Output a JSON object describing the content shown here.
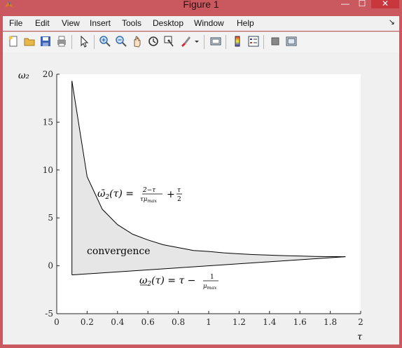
{
  "window": {
    "title": "Figure 1",
    "controls": {
      "minimize": "—",
      "maximize": "☐",
      "close": "✕"
    }
  },
  "menubar": {
    "items": [
      "File",
      "Edit",
      "View",
      "Insert",
      "Tools",
      "Desktop",
      "Window",
      "Help"
    ]
  },
  "toolbar": {
    "icons": [
      "new-figure-icon",
      "open-file-icon",
      "save-icon",
      "print-icon",
      "pointer-arrow-icon",
      "zoom-in-icon",
      "zoom-out-icon",
      "pan-hand-icon",
      "rotate-3d-icon",
      "data-cursor-icon",
      "brush-icon",
      "brush-dropdown-icon",
      "link-plot-icon",
      "colorbar-icon",
      "legend-icon",
      "hide-plot-tools-icon",
      "show-plot-tools-icon"
    ]
  },
  "chart_data": {
    "type": "area",
    "ylabel": "ω₂",
    "xlabel": "τ",
    "xlim": [
      0,
      2
    ],
    "ylim": [
      -5,
      20
    ],
    "xticks": [
      "0",
      "0.2",
      "0.4",
      "0.6",
      "0.8",
      "1",
      "1.2",
      "1.4",
      "1.6",
      "1.8",
      "2"
    ],
    "yticks": [
      "-5",
      "0",
      "5",
      "10",
      "15",
      "20"
    ],
    "grid": false,
    "fill_color": "#e6e6e6",
    "series": [
      {
        "x": [
          0.1,
          0.2,
          0.3,
          0.4,
          0.5,
          0.6,
          0.7,
          0.8,
          0.9,
          1.0,
          1.1,
          1.2,
          1.3,
          1.4,
          1.5,
          1.6,
          1.7,
          1.8,
          1.9
        ],
        "y": [
          19.3,
          9.3,
          5.9,
          4.3,
          3.3,
          2.7,
          2.2,
          1.9,
          1.6,
          1.5,
          1.35,
          1.25,
          1.17,
          1.11,
          1.06,
          1.02,
          0.98,
          0.96,
          0.95
        ]
      },
      {
        "x": [
          0.1,
          1.9
        ],
        "y": [
          -0.95,
          0.95
        ]
      }
    ],
    "annotations": {
      "upper": "ω̄₂(τ) = (2−τ)/(τμ_max) + τ/2",
      "region": "convergence",
      "lower": "ω₂(τ) = τ − 1/μ_max"
    }
  }
}
